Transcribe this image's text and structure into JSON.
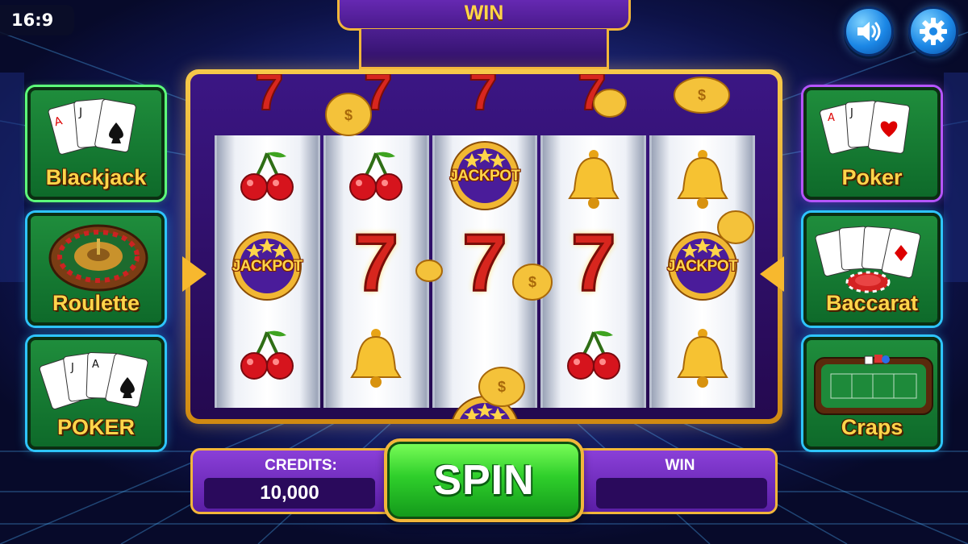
{
  "aspect_badge": "16:9",
  "win_banner": {
    "label": "WIN"
  },
  "top_controls": {
    "sound": "speaker-icon",
    "settings": "gear-icon"
  },
  "left_tiles": [
    {
      "label": "Blackjack",
      "art": "playing-cards-icon"
    },
    {
      "label": "Roulette",
      "art": "roulette-wheel-icon"
    },
    {
      "label": "POKER",
      "art": "playing-cards-icon"
    }
  ],
  "right_tiles": [
    {
      "label": "Poker",
      "art": "playing-cards-icon"
    },
    {
      "label": "Baccarat",
      "art": "cards-and-chip-icon"
    },
    {
      "label": "Craps",
      "art": "craps-table-icon"
    }
  ],
  "reels": [
    {
      "top": "cherry",
      "middle": "jackpot",
      "bottom": "cherry"
    },
    {
      "top": "cherry",
      "middle": "seven",
      "bottom": "bell"
    },
    {
      "top": "jackpot",
      "middle": "seven",
      "bottom": "jackpot"
    },
    {
      "top": "bell",
      "middle": "seven",
      "bottom": "cherry"
    },
    {
      "top": "bell",
      "middle": "jackpot",
      "bottom": "bell"
    }
  ],
  "jackpot_text": "JACKPOT",
  "seven_text": "7",
  "bottom_bar": {
    "credits_label": "CREDITS:",
    "credits_value": "10,000",
    "spin_label": "SPIN",
    "win_label": "WIN"
  },
  "colors": {
    "gold": "#f2b63a",
    "purple": "#5a1ea5",
    "spin_green": "#2fcf2b",
    "tile_green": "#1f8d3c"
  }
}
